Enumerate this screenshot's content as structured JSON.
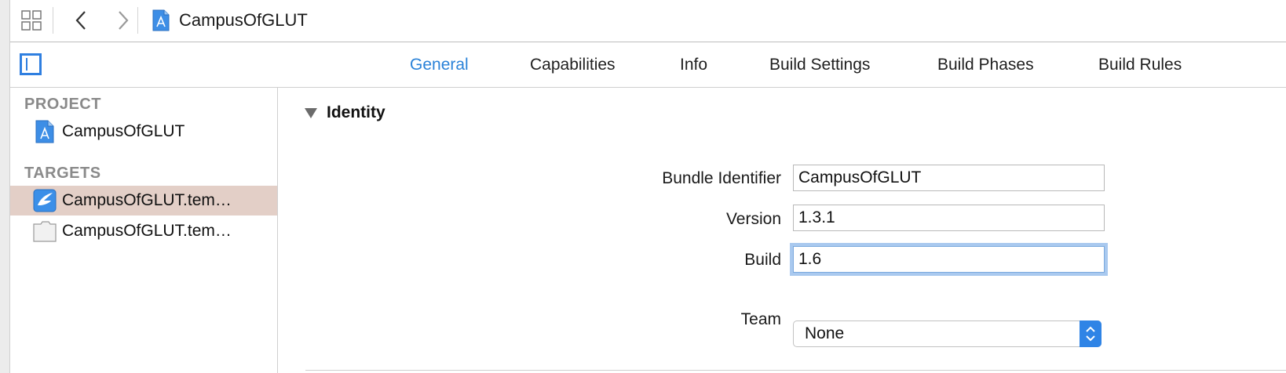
{
  "jumpbar": {
    "title": "CampusOfGLUT",
    "icons": [
      "grid-icon",
      "back-chevron-icon",
      "forward-chevron-icon",
      "xcode-project-file-icon"
    ]
  },
  "tabs": [
    {
      "label": "General",
      "active": true
    },
    {
      "label": "Capabilities",
      "active": false
    },
    {
      "label": "Info",
      "active": false
    },
    {
      "label": "Build Settings",
      "active": false
    },
    {
      "label": "Build Phases",
      "active": false
    },
    {
      "label": "Build Rules",
      "active": false
    }
  ],
  "sidebar": {
    "project_header": "PROJECT",
    "project_item": "CampusOfGLUT",
    "targets_header": "TARGETS",
    "targets": [
      {
        "label": "CampusOfGLUT.tem…",
        "selected": true,
        "icon": "app-target-icon"
      },
      {
        "label": "CampusOfGLUT.tem…",
        "selected": false,
        "icon": "bundle-target-icon"
      }
    ]
  },
  "identity": {
    "section_title": "Identity",
    "bundle_identifier_label": "Bundle Identifier",
    "bundle_identifier_value": "CampusOfGLUT",
    "version_label": "Version",
    "version_value": "1.3.1",
    "build_label": "Build",
    "build_value": "1.6",
    "team_label": "Team",
    "team_value": "None"
  },
  "colors": {
    "accent": "#2a82d8",
    "selection": "#e3cfc7",
    "focus_ring": "#a9c9ef"
  }
}
